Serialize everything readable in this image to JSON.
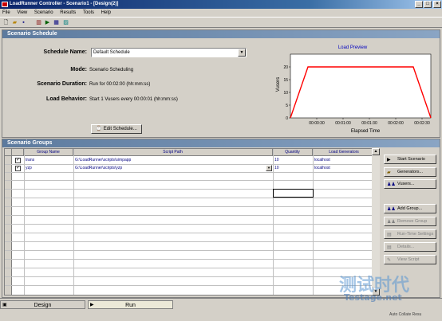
{
  "window": {
    "title": "LoadRunner Controller - Scenario1 - [Design(2)]"
  },
  "menu": [
    "File",
    "View",
    "Scenario",
    "Results",
    "Tools",
    "Help"
  ],
  "schedule": {
    "header": "Scenario Schedule",
    "name_label": "Schedule Name:",
    "name_value": "Default Schedule",
    "mode_label": "Mode:",
    "mode_value": "Scenario Scheduling",
    "duration_label": "Scenario Duration:",
    "duration_value": "Run for 00:02:00 (hh:mm:ss)",
    "behavior_label": "Load Behavior:",
    "behavior_value": "Start 1 Vusers every 00:00:01 (hh:mm:ss)",
    "edit_button": "Edit Schedule..."
  },
  "chart_data": {
    "type": "line",
    "title": "Load Preview",
    "xlabel": "Elapsed Time",
    "ylabel": "Vusers",
    "x_ticks": [
      "00:00:30",
      "00:01:00",
      "00:01:30",
      "00:02:00",
      "00:02:30"
    ],
    "y_ticks": [
      "0",
      "5",
      "10",
      "15",
      "20"
    ],
    "xlim": [
      0,
      160
    ],
    "ylim": [
      0,
      25
    ],
    "grid": false,
    "series": [
      {
        "x": [
          0,
          20,
          140,
          160
        ],
        "y": [
          0,
          20,
          20,
          0
        ],
        "color": "#ff0000"
      }
    ]
  },
  "groups": {
    "header": "Scenario Groups",
    "columns": [
      "Group Name",
      "Script Path",
      "Quantity",
      "Load Generators"
    ],
    "rows": [
      {
        "name": "trans",
        "path": "G:\\LoadRunner\\scripts\\simpapp",
        "quantity": "10",
        "generator": "localhost"
      },
      {
        "name": "yzp",
        "path": "G:\\LoadRunner\\scripts\\yzp",
        "quantity": "10",
        "generator": "localhost"
      }
    ]
  },
  "side_buttons": {
    "start": "Start Scenario",
    "generators": "Generators...",
    "vusers": "Vusers...",
    "add_group": "Add Group...",
    "remove_group": "Remove Group",
    "runtime": "Run-Time Settings",
    "details": "Details...",
    "view_script": "View Script"
  },
  "tabs": {
    "design": "Design",
    "run": "Run"
  },
  "watermark": {
    "cn": "测试时代",
    "url": "Testage.net"
  },
  "status": {
    "text": "Auto Collate Resu"
  }
}
